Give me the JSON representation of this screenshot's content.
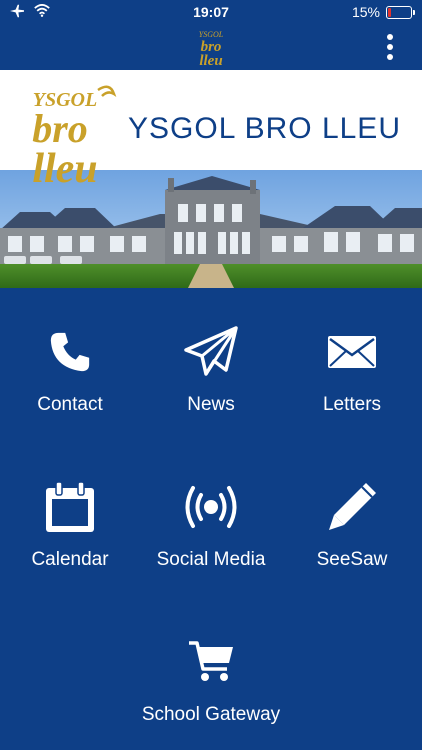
{
  "status_bar": {
    "time": "19:07",
    "battery": "15%",
    "battery_level": 0.15,
    "icons": [
      "airplane-icon",
      "wifi-icon",
      "battery-icon"
    ],
    "battery_color": "#e0322d"
  },
  "header": {
    "logo": "school-logo",
    "menu_icon": "more-vertical-icon"
  },
  "banner": {
    "title": "YSGOL BRO LLEU",
    "logo_text": [
      "YSGOL",
      "BRO",
      "LLEU"
    ]
  },
  "theme": {
    "background": "#0e3f87",
    "logo_gold": "#c9a12a"
  },
  "tiles": [
    {
      "label": "Contact",
      "icon": "phone-icon"
    },
    {
      "label": "News",
      "icon": "paper-plane-icon"
    },
    {
      "label": "Letters",
      "icon": "envelope-icon"
    },
    {
      "label": "Calendar",
      "icon": "calendar-icon"
    },
    {
      "label": "Social Media",
      "icon": "broadcast-icon"
    },
    {
      "label": "SeeSaw",
      "icon": "pencil-icon"
    },
    {
      "label": "School Gateway",
      "icon": "shopping-cart-icon"
    }
  ]
}
